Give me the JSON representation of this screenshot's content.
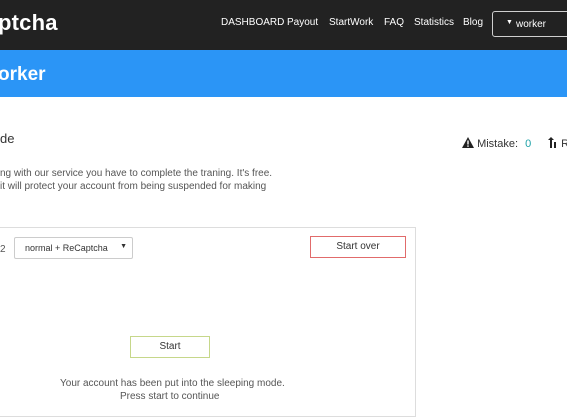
{
  "header": {
    "brand": "ptcha",
    "nav": [
      "DASHBOARD",
      "Payout",
      "StartWork",
      "FAQ",
      "Statistics",
      "Blog"
    ],
    "user_menu": {
      "caret": "▼",
      "label": "worker"
    }
  },
  "banner": {
    "title": "orker"
  },
  "training": {
    "title": "de",
    "desc_line1": "ng with our service you have to complete the traning. It's free.",
    "desc_line2": " it will protect your account from being suspended for making"
  },
  "stats": {
    "mistake_icon": "warning-icon",
    "mistake_label": "Mistake:",
    "mistake_value": "0",
    "second_icon": "rate-icon",
    "second_label": "R"
  },
  "panel": {
    "number": "2",
    "mode_select": {
      "value": "normal + ReCaptcha",
      "caret": "▼"
    },
    "start_over_label": "Start over",
    "start_label": "Start",
    "message_line1": "Your account has been put into the sleeping mode.",
    "message_line2": "Press start to continue"
  },
  "colors": {
    "topbar": "#222222",
    "banner": "#2b95f6",
    "mistake_value": "#1fa2a8",
    "start_over_border": "#e16b6b",
    "start_border": "#c6d78a"
  }
}
